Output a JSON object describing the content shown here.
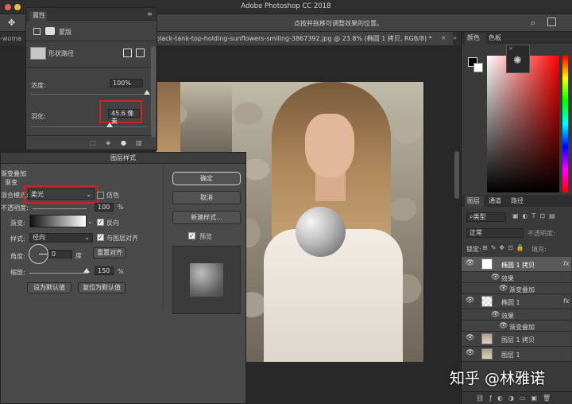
{
  "app": {
    "title": "Adobe Photoshop CC 2018"
  },
  "options_bar": {
    "hint": "点按并拖移可调整效果的位置。"
  },
  "doc": {
    "tab_left": "-woma",
    "tab_main": "black-tank-top-holding-sunflowers-smiling-3867392.jpg @ 23.8% (椭圆 1 拷贝, RGB/8) *",
    "tab_close": "×",
    "tab_more": "»"
  },
  "properties": {
    "tab": "属性",
    "mask_label": "蒙版",
    "shape_path_label": "形状路径",
    "density_label": "浓度:",
    "density_value": "100%",
    "density_level": 1.0,
    "feather_label": "羽化:",
    "feather_value": "45.6 像素",
    "feather_level": 0.456
  },
  "layer_style": {
    "title": "图层样式",
    "section": "渐变叠加",
    "subsection": "渐变",
    "blend_mode_label": "混合模式:",
    "blend_mode_value": "柔光",
    "dither_label": "仿色",
    "dither_checked": false,
    "opacity_label": "不透明度:",
    "opacity_value": "100",
    "opacity_unit": "%",
    "gradient_label": "渐变:",
    "reverse_label": "反向",
    "reverse_checked": true,
    "style_label": "样式:",
    "style_value": "径向",
    "align_label": "与图层对齐",
    "align_checked": true,
    "angle_label": "角度:",
    "angle_value": "0",
    "angle_unit": "度",
    "reset_align": "重置对齐",
    "scale_label": "缩放:",
    "scale_value": "150",
    "scale_unit": "%",
    "set_default": "设为默认值",
    "reset_default": "复位为默认值",
    "ok": "确定",
    "cancel": "取消",
    "new_style": "新建样式...",
    "preview_label": "预览",
    "preview_checked": true
  },
  "color_panel": {
    "tabs": [
      "颜色",
      "色板"
    ]
  },
  "layers_panel": {
    "tabs": [
      "图层",
      "通道",
      "路径"
    ],
    "search_placeholder": "类型",
    "blend_mode": "正常",
    "opacity_label": "不透明度:",
    "lock_label": "锁定:",
    "fill_label": "填充:",
    "layers": [
      {
        "name": "椭圆 1 拷贝",
        "fx": "fx",
        "effects_label": "效果",
        "effect": "渐变叠加"
      },
      {
        "name": "椭圆 1",
        "fx": "fx",
        "effects_label": "效果",
        "effect": "渐变叠加"
      },
      {
        "name": "图层 1 拷贝"
      },
      {
        "name": "图层 1"
      }
    ]
  },
  "watermark": "知乎 @林雅诺",
  "colors": {
    "highlight": "#d32020",
    "accent_border": "#cfcfcf"
  }
}
